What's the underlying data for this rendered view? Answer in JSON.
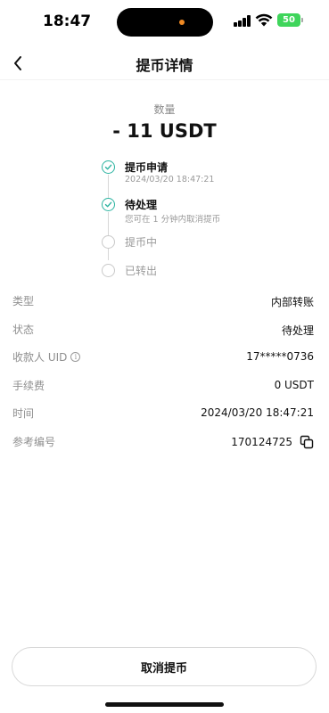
{
  "status_bar": {
    "time": "18:47",
    "battery": "50"
  },
  "nav": {
    "title": "提币详情"
  },
  "amount": {
    "label": "数量",
    "value": "- 11 USDT"
  },
  "timeline": [
    {
      "title": "提币申请",
      "subtitle": "2024/03/20 18:47:21",
      "state": "done"
    },
    {
      "title": "待处理",
      "subtitle": "您可在 1 分钟内取消提币",
      "state": "done"
    },
    {
      "title": "提币中",
      "subtitle": "",
      "state": "pending"
    },
    {
      "title": "已转出",
      "subtitle": "",
      "state": "pending"
    }
  ],
  "details": [
    {
      "label": "类型",
      "value": "内部转账"
    },
    {
      "label": "状态",
      "value": "待处理"
    },
    {
      "label": "收款人 UID",
      "value": "17*****0736"
    },
    {
      "label": "手续费",
      "value": "0 USDT"
    },
    {
      "label": "时间",
      "value": "2024/03/20 18:47:21"
    },
    {
      "label": "参考编号",
      "value": "170124725"
    }
  ],
  "actions": {
    "cancel_label": "取消提币"
  },
  "colors": {
    "accent": "#2bb3a0",
    "battery": "#3fd55b",
    "island_dot": "#f08a24"
  }
}
